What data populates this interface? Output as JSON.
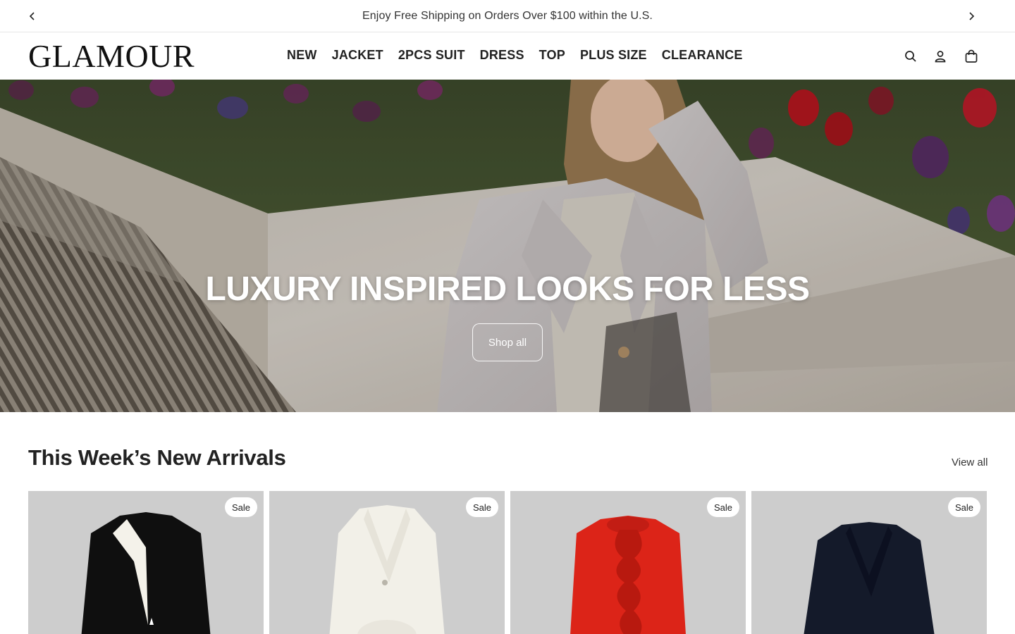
{
  "announcement": {
    "text": "Enjoy Free Shipping on Orders Over $100 within the U.S.",
    "prev_icon": "chevron-left-icon",
    "next_icon": "chevron-right-icon"
  },
  "header": {
    "logo": "GLAMOUR",
    "nav": [
      "NEW",
      "JACKET",
      "2PCS SUIT",
      "DRESS",
      "TOP",
      "PLUS SIZE",
      "CLEARANCE"
    ],
    "icons": [
      "search-icon",
      "account-icon",
      "cart-icon"
    ]
  },
  "hero": {
    "title": "LUXURY INSPIRED LOOKS FOR LESS",
    "button_label": "Shop all"
  },
  "new_arrivals": {
    "title": "This Week’s New Arrivals",
    "view_all": "View all",
    "products": [
      {
        "badge": "Sale",
        "color": "#111111"
      },
      {
        "badge": "Sale",
        "color": "#f4f2ea"
      },
      {
        "badge": "Sale",
        "color": "#d9261c"
      },
      {
        "badge": "Sale",
        "color": "#141a2a"
      }
    ]
  }
}
